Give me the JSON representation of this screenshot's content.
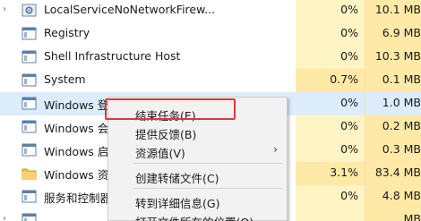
{
  "processes": [
    {
      "name": "LocalServiceNoNetworkFirew...",
      "cpu": "0%",
      "memory": "10.1 MB",
      "icon": "gear-icon",
      "expandable": true,
      "selected": false,
      "cpu_color": "#fff4c4",
      "mem_color": "#ffe9a6"
    },
    {
      "name": "Registry",
      "cpu": "0%",
      "memory": "6.9 MB",
      "icon": "window-icon",
      "expandable": false,
      "selected": false,
      "cpu_color": "#fff4c4",
      "mem_color": "#ffe9a6"
    },
    {
      "name": "Shell Infrastructure Host",
      "cpu": "0%",
      "memory": "10.3 MB",
      "icon": "window-icon",
      "expandable": false,
      "selected": false,
      "cpu_color": "#fff4c4",
      "mem_color": "#ffe9a6"
    },
    {
      "name": "System",
      "cpu": "0.7%",
      "memory": "0.1 MB",
      "icon": "window-icon",
      "expandable": false,
      "selected": false,
      "cpu_color": "#ffe9a6",
      "mem_color": "#ffe9a6"
    },
    {
      "name": "Windows 登",
      "cpu": "0%",
      "memory": "1.0 MB",
      "icon": "window-icon",
      "expandable": false,
      "selected": true,
      "cpu_color": "#dcecfb",
      "mem_color": "#dcecfb"
    },
    {
      "name": "Windows 会",
      "cpu": "0%",
      "memory": "0.2 MB",
      "icon": "window-icon",
      "expandable": false,
      "selected": false,
      "cpu_color": "#fff4c4",
      "mem_color": "#ffe9a6"
    },
    {
      "name": "Windows 启",
      "cpu": "0%",
      "memory": "0.3 MB",
      "icon": "window-icon",
      "expandable": false,
      "selected": false,
      "cpu_color": "#fff4c4",
      "mem_color": "#ffe9a6"
    },
    {
      "name": "Windows 资",
      "cpu": "3.1%",
      "memory": "83.4 MB",
      "icon": "folder-icon",
      "expandable": false,
      "selected": false,
      "cpu_color": "#ffe9a6",
      "mem_color": "#ffe9a6"
    },
    {
      "name": "服务和控制器",
      "cpu": "0%",
      "memory": "4.8 MB",
      "icon": "window-icon",
      "expandable": false,
      "selected": false,
      "cpu_color": "#fff4c4",
      "mem_color": "#ffe9a6"
    },
    {
      "name": "",
      "cpu": "",
      "memory": "MB",
      "icon": "window-icon",
      "expandable": true,
      "selected": false,
      "cpu_color": "#fff4c4",
      "mem_color": "#ffe9a6"
    }
  ],
  "context_menu": {
    "items": [
      {
        "label": "结束任务(E)",
        "submenu": false,
        "separator_after": false
      },
      {
        "label": "提供反馈(B)",
        "submenu": false,
        "separator_after": false
      },
      {
        "label": "资源值(V)",
        "submenu": true,
        "separator_after": true
      },
      {
        "label": "创建转储文件(C)",
        "submenu": false,
        "separator_after": true
      },
      {
        "label": "转到详细信息(G)",
        "submenu": false,
        "separator_after": false
      },
      {
        "label": "打开文件所在的位置(O)",
        "submenu": false,
        "separator_after": false
      }
    ],
    "highlight_color": "#e0373a"
  }
}
